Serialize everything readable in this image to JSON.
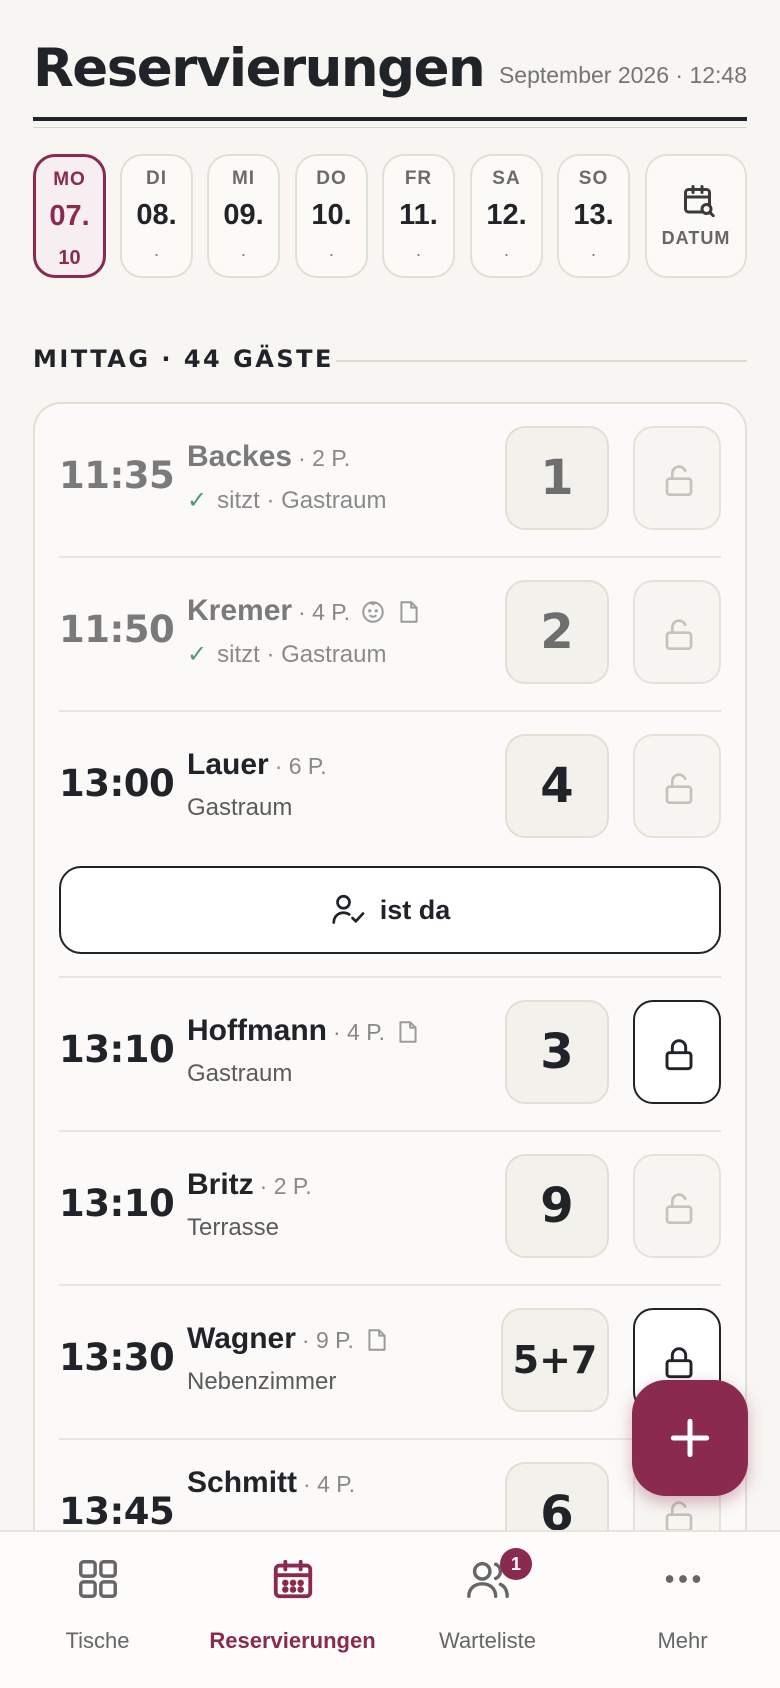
{
  "header": {
    "title": "Reservierungen",
    "meta": "September 2026 · 12:48"
  },
  "days": [
    {
      "dow": "MO",
      "num": "07.",
      "count": "10",
      "active": true
    },
    {
      "dow": "DI",
      "num": "08.",
      "count": "·"
    },
    {
      "dow": "MI",
      "num": "09.",
      "count": "·"
    },
    {
      "dow": "DO",
      "num": "10.",
      "count": "·"
    },
    {
      "dow": "FR",
      "num": "11.",
      "count": "·"
    },
    {
      "dow": "SA",
      "num": "12.",
      "count": "·"
    },
    {
      "dow": "SO",
      "num": "13.",
      "count": "·"
    }
  ],
  "date_picker": {
    "label": "DATUM",
    "icon": "calendar-search-icon"
  },
  "section": {
    "title": "MITTAG · 44 GÄSTE"
  },
  "reservations": [
    {
      "time": "11:35",
      "name": "Backes",
      "persons": "· 2 P.",
      "status": "sitzt · Gastraum",
      "seated": true,
      "table": "1",
      "locked": false
    },
    {
      "time": "11:50",
      "name": "Kremer",
      "persons": "· 4 P.",
      "status": "sitzt · Gastraum",
      "seated": true,
      "table": "2",
      "locked": false,
      "icons": [
        "child-icon",
        "note-icon"
      ]
    },
    {
      "time": "13:00",
      "name": "Lauer",
      "persons": "· 6 P.",
      "status": "Gastraum",
      "table": "4",
      "locked": false,
      "action": "ist da"
    },
    {
      "time": "13:10",
      "name": "Hoffmann",
      "persons": "· 4 P.",
      "status": "Gastraum",
      "table": "3",
      "locked": true,
      "icons": [
        "note-icon"
      ]
    },
    {
      "time": "13:10",
      "name": "Britz",
      "persons": "· 2 P.",
      "status": "Terrasse",
      "table": "9",
      "locked": false
    },
    {
      "time": "13:30",
      "name": "Wagner",
      "persons": "· 9 P.",
      "status": "Nebenzimmer",
      "table": "5+7",
      "locked": true,
      "icons": [
        "note-icon"
      ]
    },
    {
      "time": "13:45",
      "name": "Schmitt",
      "persons": "· 4 P.",
      "status": "",
      "table": "6",
      "locked": false
    }
  ],
  "fab": {
    "icon": "plus-icon"
  },
  "tabs": [
    {
      "label": "Tische",
      "icon": "grid-icon"
    },
    {
      "label": "Reservierungen",
      "icon": "calendar-icon",
      "active": true
    },
    {
      "label": "Warteliste",
      "icon": "users-icon",
      "badge": "1"
    },
    {
      "label": "Mehr",
      "icon": "more-icon"
    }
  ],
  "colors": {
    "accent": "#8b2a4f",
    "check": "#4e9b72",
    "background": "#f8f6f2"
  }
}
